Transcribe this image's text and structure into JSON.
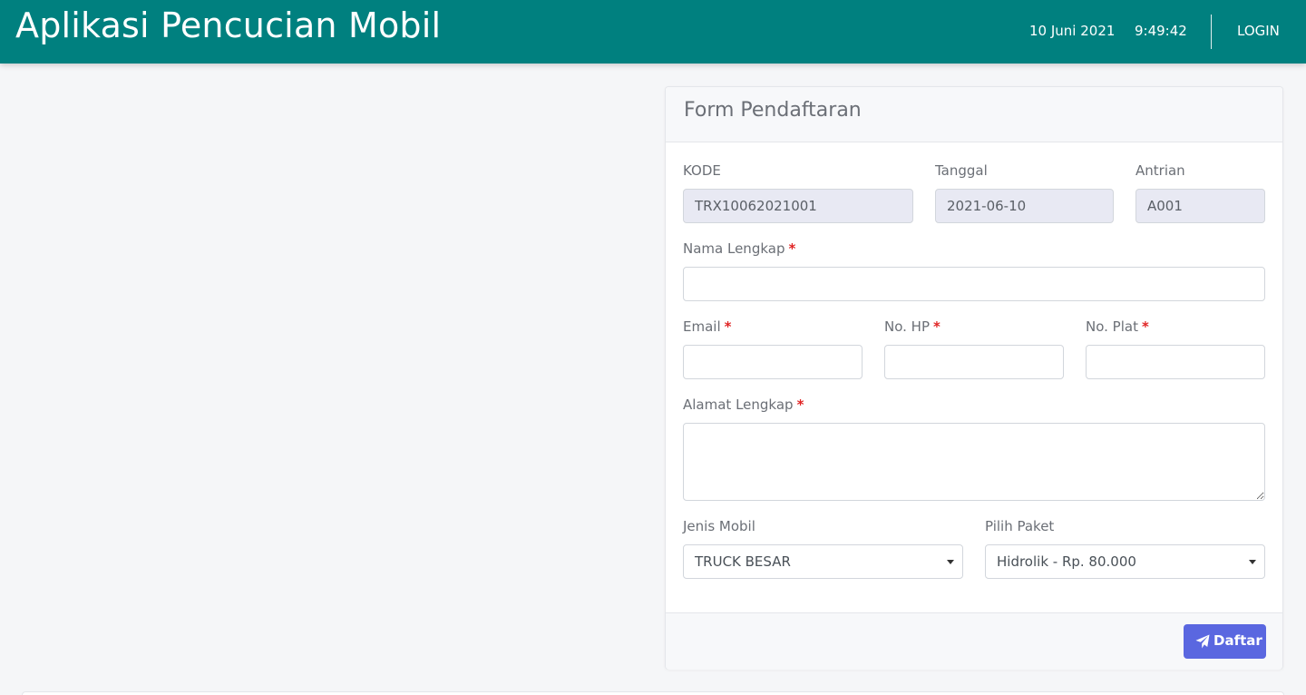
{
  "navbar": {
    "brand": "Aplikasi Pencucian Mobil",
    "date": "10 Juni 2021",
    "time": "9:49:42",
    "login_label": "LOGIN"
  },
  "form": {
    "title": "Form Pendaftaran",
    "kode": {
      "label": "KODE",
      "value": "TRX10062021001"
    },
    "tanggal": {
      "label": "Tanggal",
      "value": "2021-06-10"
    },
    "antrian": {
      "label": "Antrian",
      "value": "A001"
    },
    "nama": {
      "label": "Nama Lengkap",
      "required": "*",
      "value": ""
    },
    "email": {
      "label": "Email",
      "required": "*",
      "value": ""
    },
    "hp": {
      "label": "No. HP",
      "required": "*",
      "value": ""
    },
    "plat": {
      "label": "No. Plat",
      "required": "*",
      "value": ""
    },
    "alamat": {
      "label": "Alamat Lengkap",
      "required": "*",
      "value": ""
    },
    "jenis_mobil": {
      "label": "Jenis Mobil",
      "selected": "TRUCK BESAR"
    },
    "paket": {
      "label": "Pilih Paket",
      "selected": "Hidrolik - Rp. 80.000"
    },
    "submit_label": "Daftar",
    "submit_icon": "paper-plane-icon"
  },
  "colors": {
    "navbar": "#00807f",
    "button": "#5a67e0",
    "required": "#e02424",
    "readonly_bg": "#e8e9f3"
  }
}
